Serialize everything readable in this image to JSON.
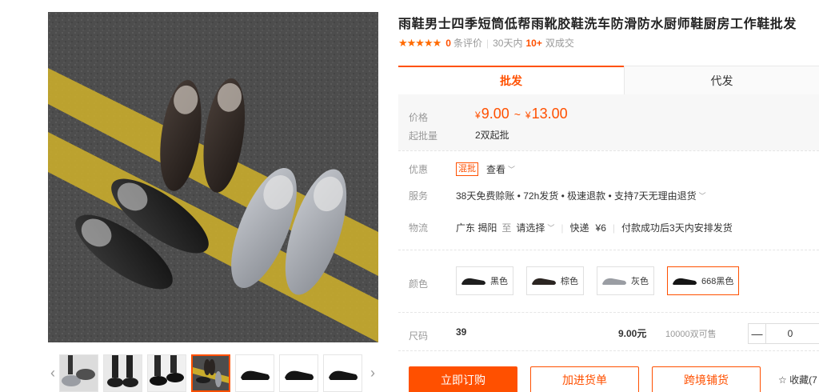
{
  "gallery": {
    "prev_arrow": "‹",
    "next_arrow": "›",
    "thumbnail_count": 7,
    "active_thumbnail_index": 3
  },
  "product": {
    "title": "雨鞋男士四季短筒低帮雨靴胶鞋洗车防滑防水厨师鞋厨房工作鞋批发",
    "stars": "★★★★★",
    "review_count": "0",
    "review_label": "条评价",
    "sales_period": "30天内",
    "sales_count": "10+",
    "sales_unit": "双成交"
  },
  "tabs": [
    {
      "label": "批发",
      "active": true
    },
    {
      "label": "代发",
      "active": false
    }
  ],
  "price": {
    "label": "价格",
    "currency": "¥",
    "low": "9.00",
    "tilde": "~",
    "high": "13.00",
    "moq_label": "起批量",
    "moq_value": "2双起批"
  },
  "promo": {
    "label": "优惠",
    "badge": "混批",
    "link": "查看",
    "chevron": "﹀"
  },
  "service": {
    "label": "服务",
    "text": "38天免费赊账 • 72h发货 • 极速退款 • 支持7天无理由退货",
    "chevron": "﹀"
  },
  "shipping": {
    "label": "物流",
    "origin": "广东 揭阳",
    "to": "至",
    "destination": "请选择",
    "chevron": "﹀",
    "express": "快递",
    "fee": "¥6",
    "note": "付款成功后3天内安排发货"
  },
  "colors": {
    "label": "颜色",
    "options": [
      {
        "name": "黑色",
        "swatch": "#1e1e1e",
        "selected": false
      },
      {
        "name": "棕色",
        "swatch": "#2b2522",
        "selected": false
      },
      {
        "name": "灰色",
        "swatch": "#9a9da3",
        "selected": false
      },
      {
        "name": "668黑色",
        "swatch": "#151515",
        "selected": true
      }
    ]
  },
  "size": {
    "label": "尺码",
    "value": "39",
    "price": "9.00元",
    "stock": "10000双可售",
    "minus": "—",
    "quantity": "0"
  },
  "actions": {
    "buy": "立即订购",
    "cart": "加进货单",
    "cross_border": "跨境铺货",
    "favorite": "☆ 收藏(7"
  },
  "accent_color": "#ff5000"
}
